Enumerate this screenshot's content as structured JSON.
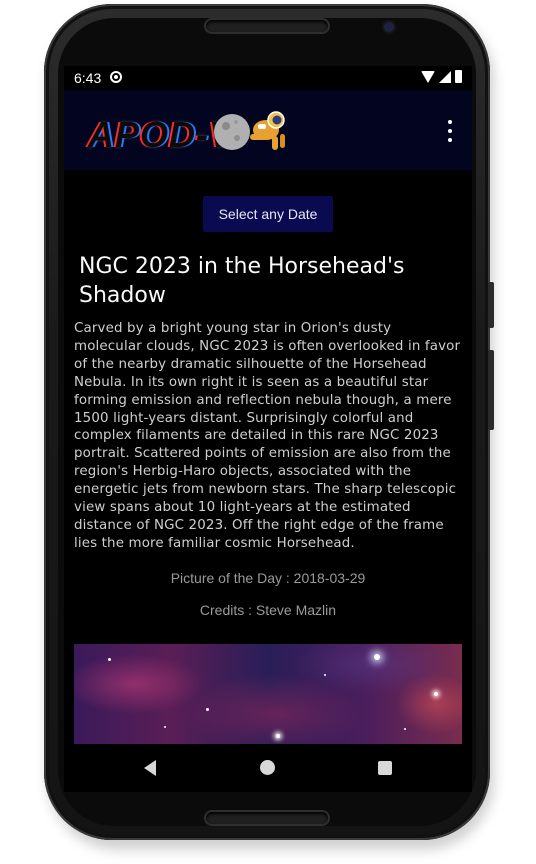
{
  "status_bar": {
    "time": "6:43",
    "icons": [
      "sync-icon",
      "wifi-icon",
      "cellular-icon",
      "battery-icon"
    ]
  },
  "app_bar": {
    "logo_text": "APOD-V",
    "overflow_icon": "more-vert-icon",
    "background": "#03041f"
  },
  "main": {
    "select_date_label": "Select any Date",
    "title": "NGC 2023 in the Horsehead's Shadow",
    "explanation": "Carved by a bright young star in Orion's dusty molecular clouds, NGC 2023 is often overlooked in favor of the nearby dramatic silhouette of the Horsehead Nebula. In its own right it is seen as a beautiful star forming emission and reflection nebula though, a mere 1500 light-years distant. Surprisingly colorful and complex filaments are detailed in this rare NGC 2023 portrait. Scattered points of emission are also from the region's Herbig-Haro objects, associated with the energetic jets from newborn stars. The sharp telescopic view spans about 10 light-years at the estimated distance of NGC 2023. Off the right edge of the frame lies the more familiar cosmic Horsehead.",
    "picture_date": "Picture of the Day : 2018-03-29",
    "credits": "Credits : Steve Mazlin",
    "button_color": "#0a0a50"
  },
  "nav_bar": {
    "icons": [
      "back-icon",
      "home-icon",
      "recents-icon"
    ]
  }
}
